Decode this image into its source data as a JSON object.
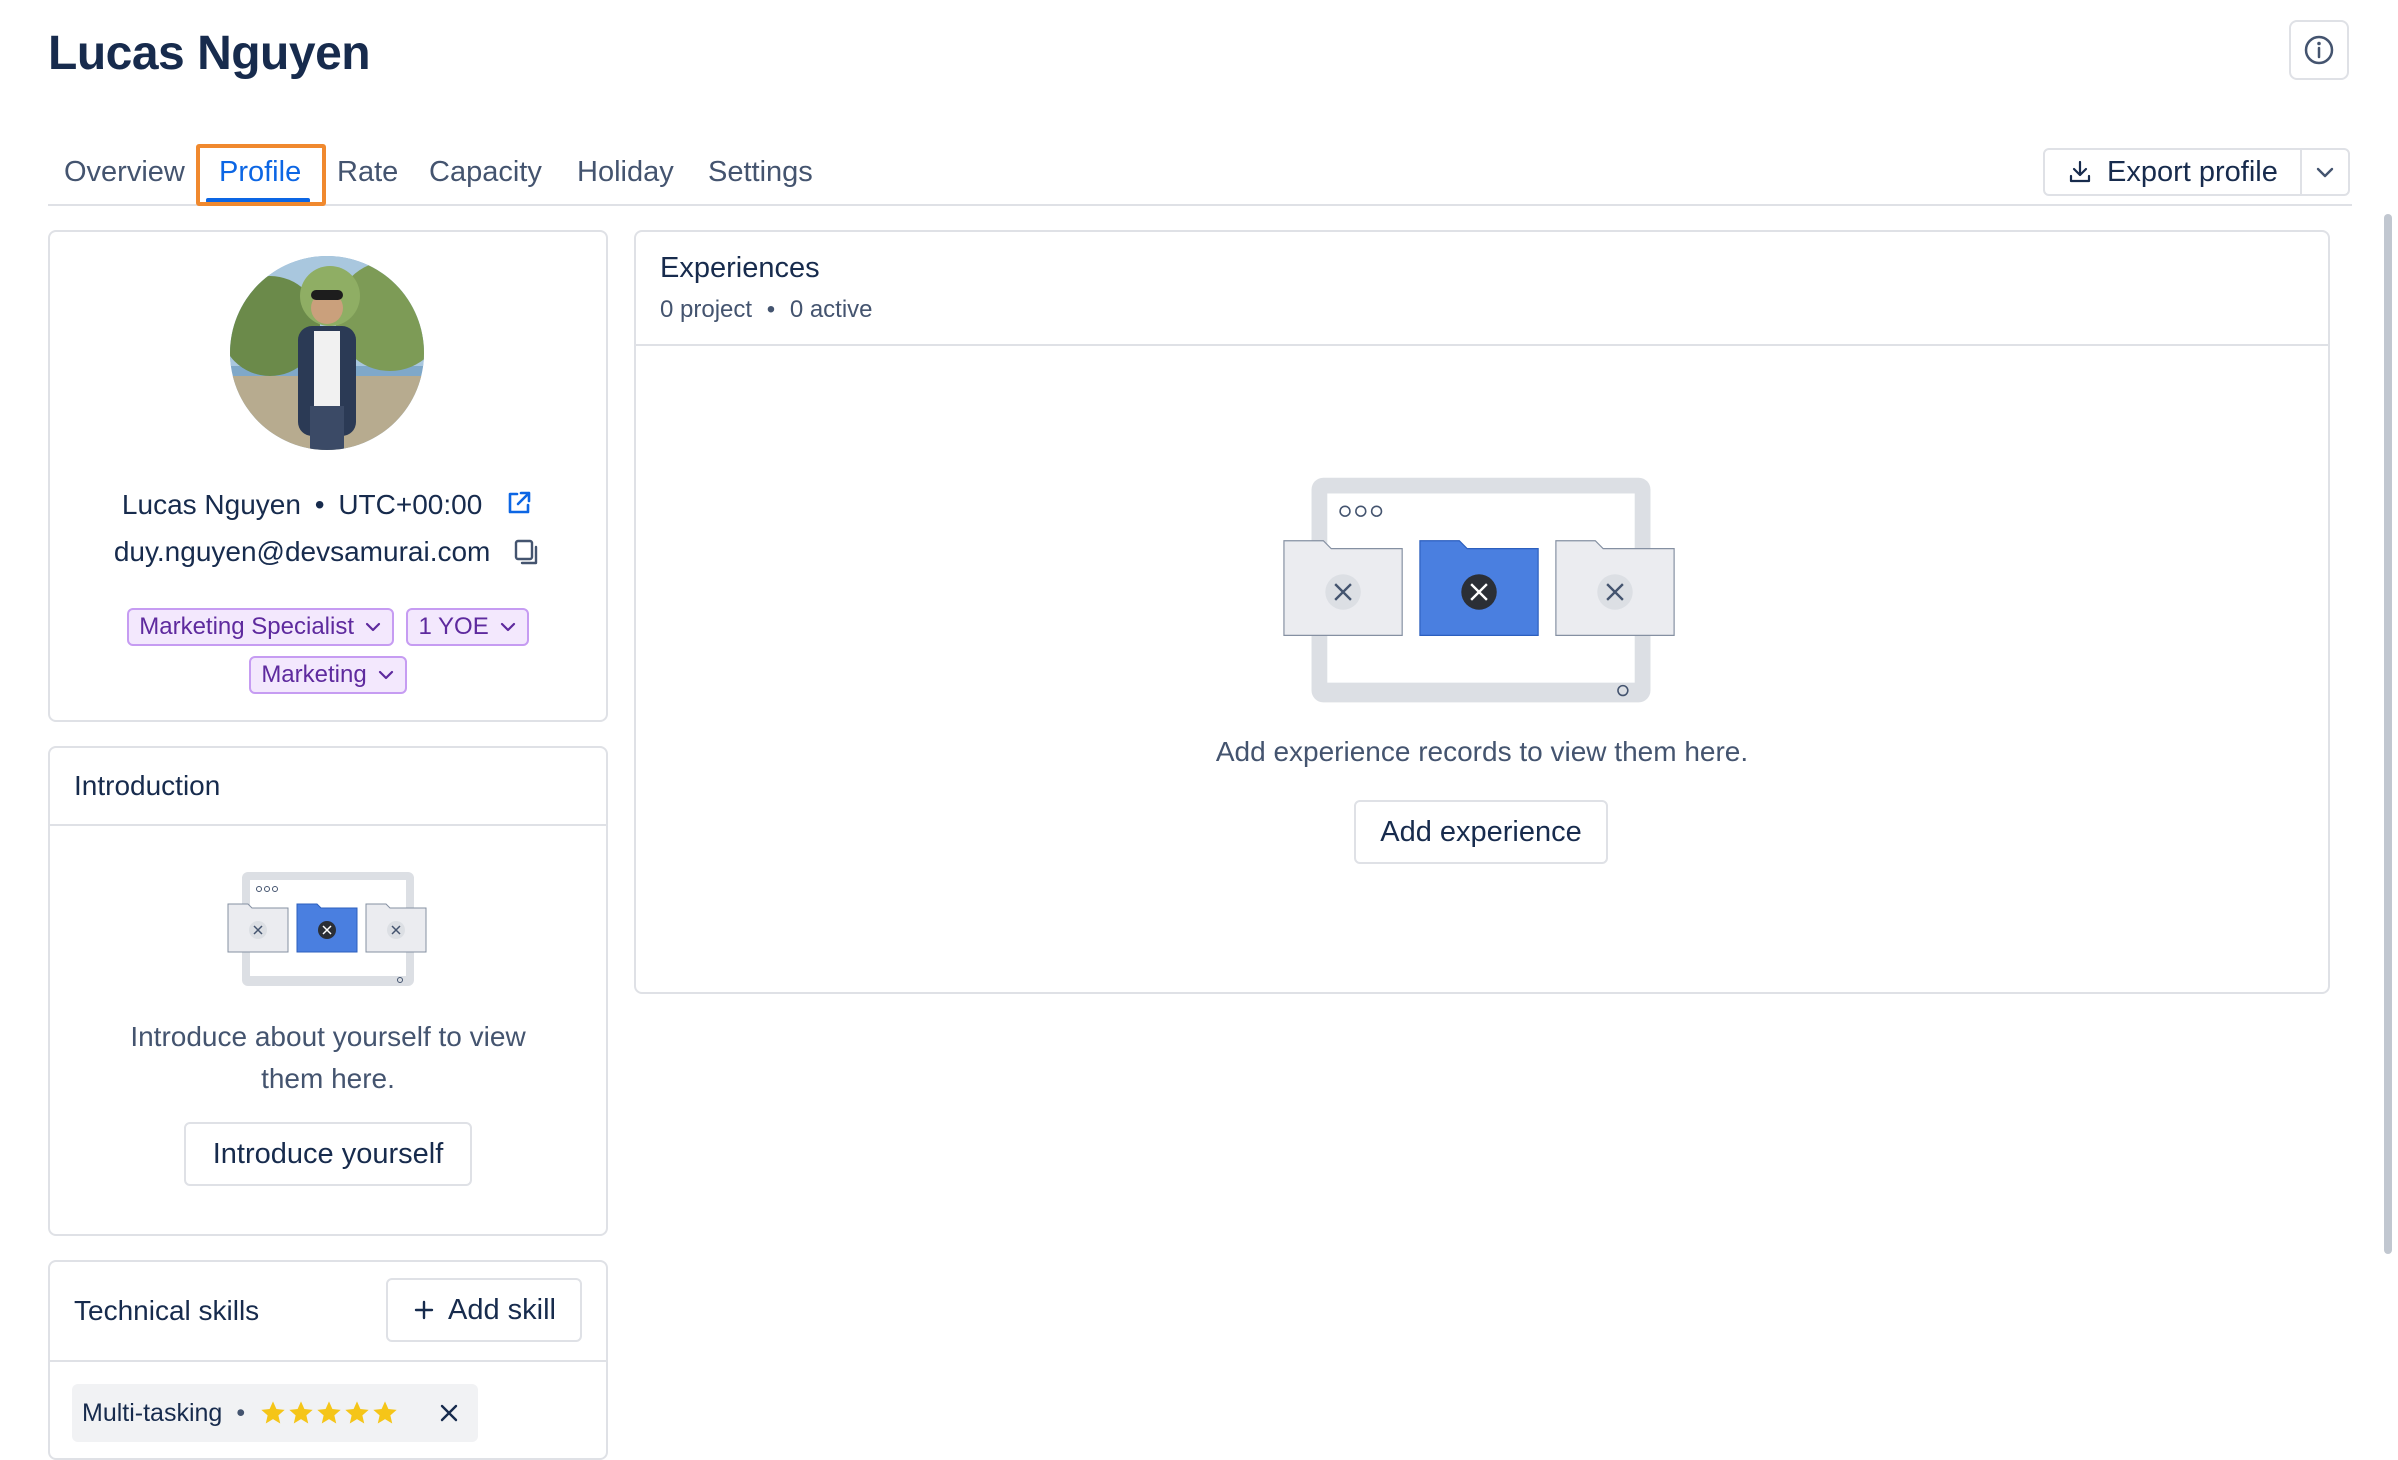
{
  "page": {
    "title": "Lucas Nguyen"
  },
  "tabs": [
    {
      "label": "Overview"
    },
    {
      "label": "Profile",
      "active": true
    },
    {
      "label": "Rate"
    },
    {
      "label": "Capacity"
    },
    {
      "label": "Holiday"
    },
    {
      "label": "Settings"
    }
  ],
  "toolbar": {
    "export_label": "Export profile"
  },
  "profile": {
    "name": "Lucas Nguyen",
    "separator": "•",
    "timezone": "UTC+00:00",
    "email": "duy.nguyen@devsamurai.com",
    "chips": [
      {
        "label": "Marketing Specialist"
      },
      {
        "label": "1 YOE"
      },
      {
        "label": "Marketing"
      }
    ]
  },
  "introduction": {
    "title": "Introduction",
    "empty_text": "Introduce about yourself to view them here.",
    "button_label": "Introduce yourself"
  },
  "skills": {
    "title": "Technical skills",
    "add_label": "Add skill",
    "items": [
      {
        "name": "Multi-tasking",
        "rating": 5,
        "max": 5
      }
    ]
  },
  "experiences": {
    "title": "Experiences",
    "project_count": "0 project",
    "separator": "•",
    "active_count": "0 active",
    "empty_text": "Add experience records to view them here.",
    "button_label": "Add experience"
  },
  "colors": {
    "accent": "#0c66e4",
    "chip_bg": "#f3e8fd",
    "chip_border": "#c69cf2",
    "highlight": "#f0892e",
    "star": "#f5c518"
  }
}
